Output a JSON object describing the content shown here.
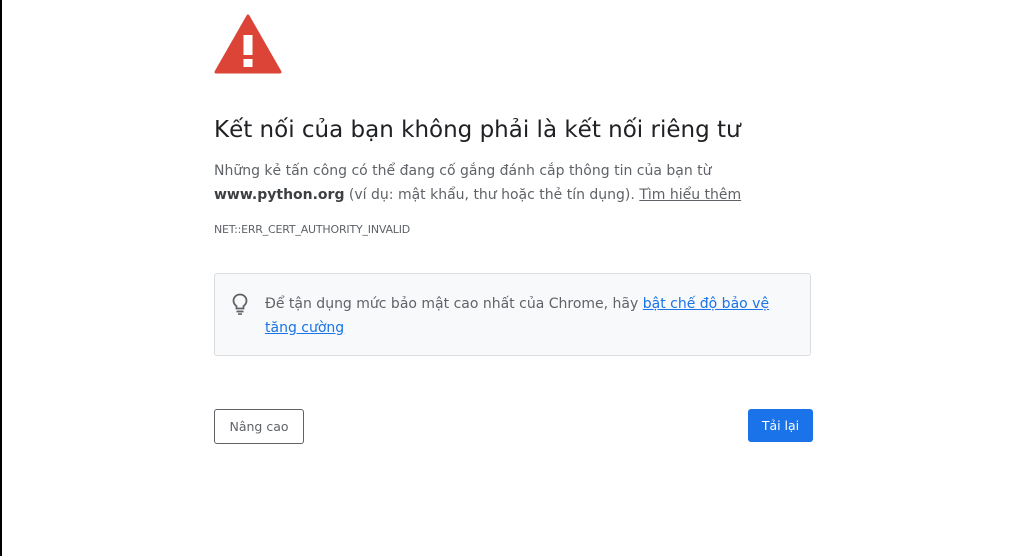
{
  "interstitial": {
    "icon": "warning-triangle-icon",
    "icon_color": "#db4437",
    "heading": "Kết nối của bạn không phải là kết nối riêng tư",
    "explanation_prefix": "Những kẻ tấn công có thể đang cố gắng đánh cắp thông tin của bạn từ ",
    "domain": "www.python.org",
    "explanation_suffix": " (ví dụ: mật khẩu, thư hoặc thẻ tín dụng). ",
    "learn_more": "Tìm hiểu thêm",
    "error_code": "NET::ERR_CERT_AUTHORITY_INVALID"
  },
  "promo": {
    "icon": "lightbulb-icon",
    "text": "Để tận dụng mức bảo mật cao nhất của Chrome, hãy ",
    "link": "bật chế độ bảo vệ tăng cường"
  },
  "buttons": {
    "advanced": "Nâng cao",
    "reload": "Tải lại"
  },
  "colors": {
    "accent": "#1a73e8",
    "warning": "#db4437"
  }
}
